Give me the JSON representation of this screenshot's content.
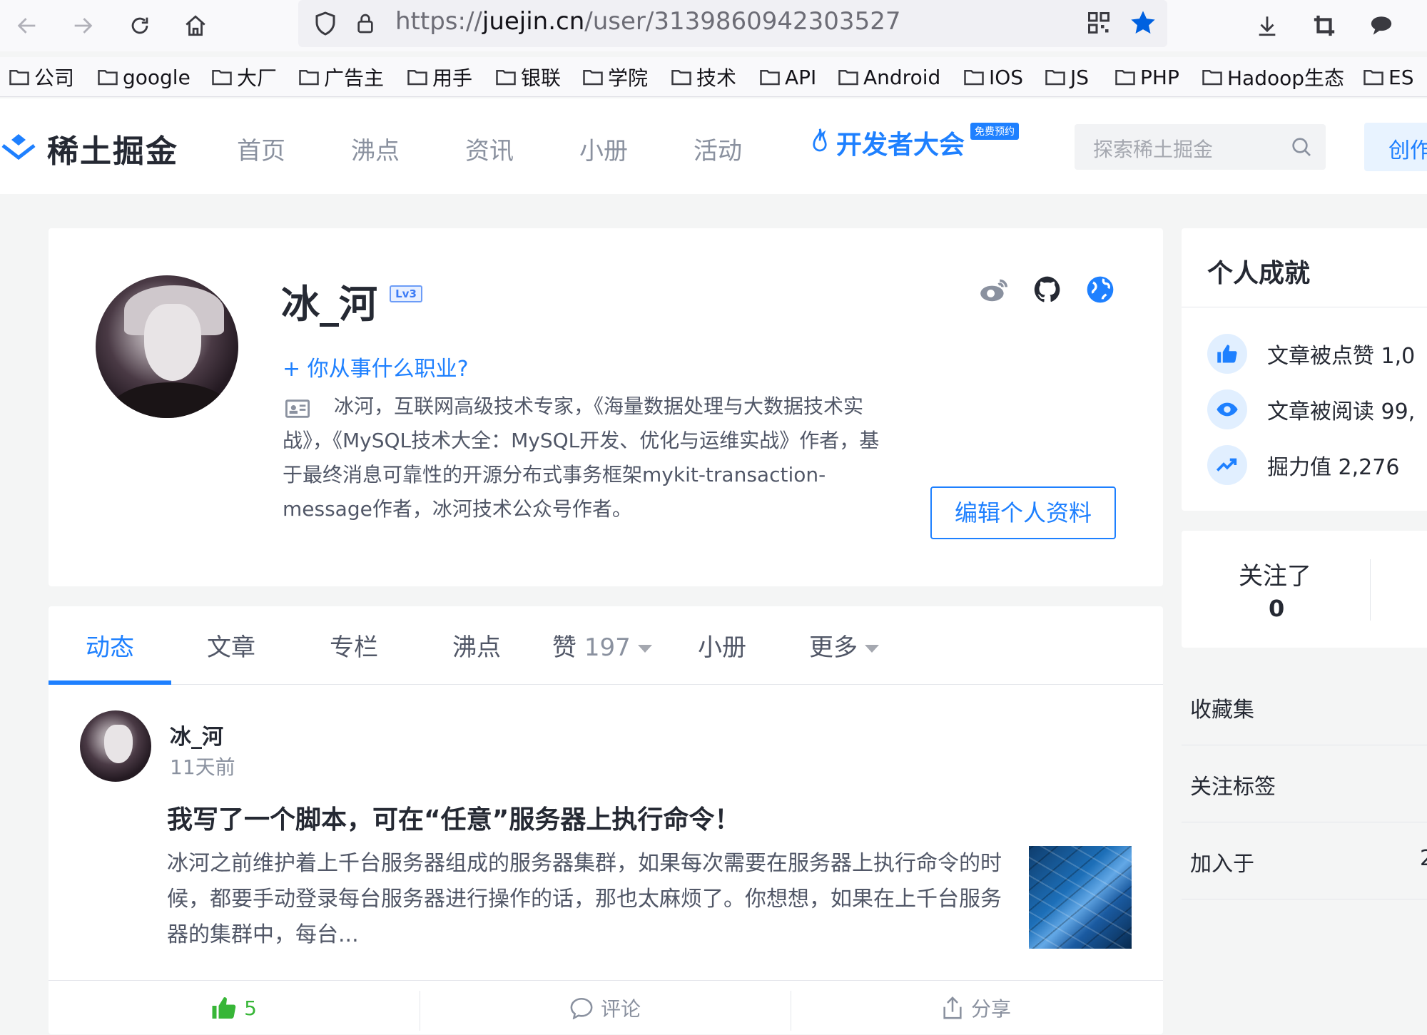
{
  "browser": {
    "url_prefix": "https://",
    "url_domain": "juejin.cn",
    "url_path": "/user/3139860942303527",
    "bookmarks": [
      "公司",
      "google",
      "大厂",
      "广告主",
      "用手",
      "银联",
      "学院",
      "技术",
      "API",
      "Android",
      "IOS",
      "JS",
      "PHP",
      "Hadoop生态",
      "ES"
    ]
  },
  "site": {
    "logo_text": "稀土掘金",
    "nav": [
      "首页",
      "沸点",
      "资讯",
      "小册",
      "活动"
    ],
    "conference": "开发者大会",
    "conference_badge": "免费预约",
    "search_placeholder": "探索稀土掘金",
    "create_label": "创作者中心"
  },
  "profile": {
    "name": "冰_河",
    "level": "Lv3",
    "job_prompt": "+ 你从事什么职业?",
    "bio": "冰河，互联网高级技术专家，《海量数据处理与大数据技术实战》，《MySQL技术大全：MySQL开发、优化与运维实战》作者，基于最终消息可靠性的开源分布式事务框架mykit-transaction-message作者，冰河技术公众号作者。",
    "edit_button": "编辑个人资料"
  },
  "tabs": {
    "items": [
      "动态",
      "文章",
      "专栏",
      "沸点",
      "赞",
      "小册",
      "更多"
    ],
    "likes_count": "197"
  },
  "post": {
    "author": "冰_河",
    "time": "11天前",
    "title": "我写了一个脚本，可在“任意”服务器上执行命令！",
    "excerpt": "冰河之前维护着上千台服务器组成的服务器集群，如果每次需要在服务器上执行命令的时候，都要手动登录每台服务器进行操作的话，那也太麻烦了。你想想，如果在上千台服务器的集群中，每台...",
    "like_count": "5",
    "comment_label": "评论",
    "share_label": "分享"
  },
  "achievements": {
    "title": "个人成就",
    "likes": "文章被点赞 1,0",
    "reads": "文章被阅读 99,",
    "power": "掘力值 2,276"
  },
  "follow": {
    "following_label": "关注了",
    "following_value": "0"
  },
  "side": {
    "collections": "收藏集",
    "tags": "关注标签",
    "joined": "加入于",
    "joined_value": "2"
  },
  "colors": {
    "brand": "#1e80ff",
    "like_green": "#37b637"
  }
}
